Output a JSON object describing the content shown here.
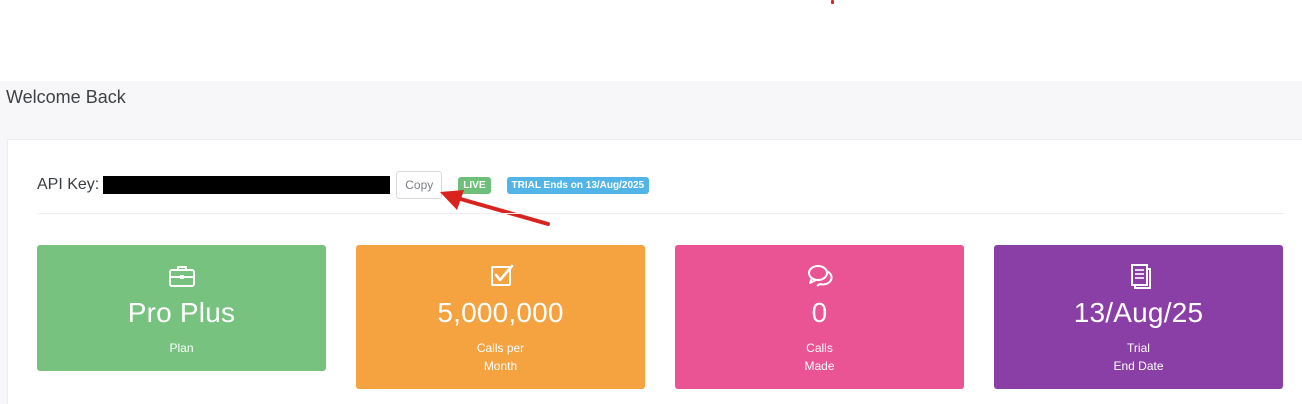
{
  "page": {
    "title": "Welcome Back"
  },
  "api": {
    "label": "API Key:",
    "copy_label": "Copy",
    "badges": {
      "live": "LIVE",
      "trial": "TRIAL Ends on 13/Aug/2025"
    }
  },
  "cards": [
    {
      "icon": "briefcase-icon",
      "value": "Pro Plus",
      "label_lines": [
        "Plan"
      ],
      "color": "#76c27e"
    },
    {
      "icon": "checkbox-icon",
      "value": "5,000,000",
      "label_lines": [
        "Calls per",
        "Month"
      ],
      "color": "#f5a340"
    },
    {
      "icon": "chat-bubbles-icon",
      "value": "0",
      "label_lines": [
        "Calls",
        "Made"
      ],
      "color": "#ea5494"
    },
    {
      "icon": "document-icon",
      "value": "13/Aug/25",
      "label_lines": [
        "Trial",
        "End Date"
      ],
      "color": "#8a3fa6"
    }
  ],
  "colors": {
    "annotation_arrow": "#d9231f",
    "page_background": "#f7f7f9"
  }
}
